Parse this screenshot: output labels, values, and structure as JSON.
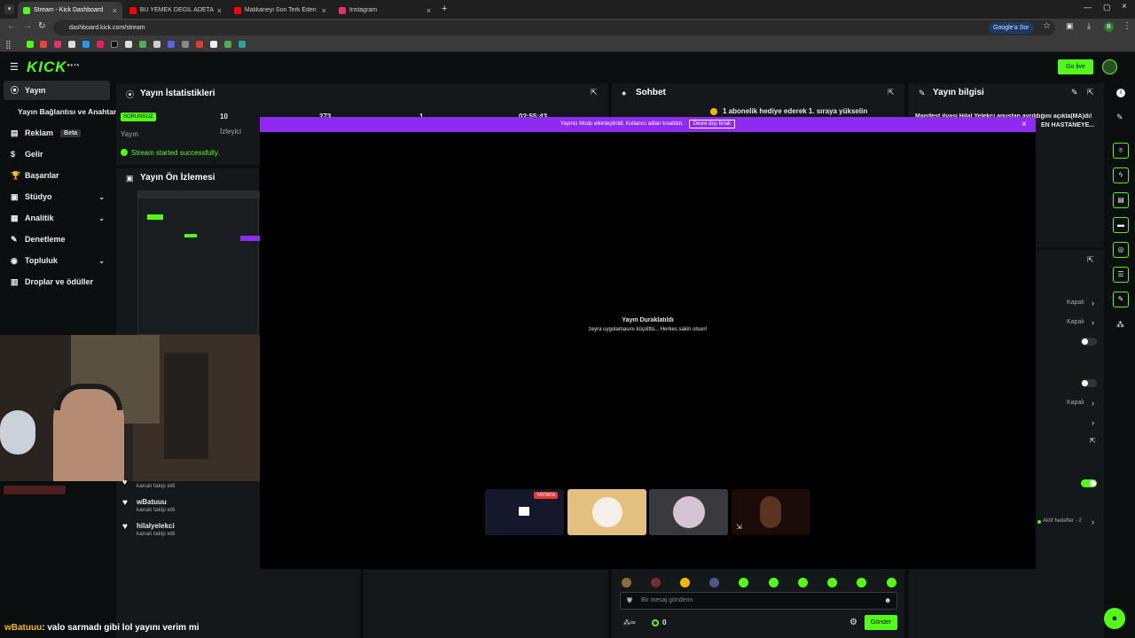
{
  "browser": {
    "tabs": [
      {
        "label": "Stream - Kick Dashboard",
        "color": "#53fc18"
      },
      {
        "label": "BU YEMEK DEĞİL ADETA ŞÖLEN",
        "color": "#ff0000"
      },
      {
        "label": "Malikaneyi Son Terk Eden Kazan",
        "color": "#ff0000"
      },
      {
        "label": "Instagram",
        "color": "#e1306c"
      }
    ],
    "url": "dashboard.kick.com/stream",
    "google_sor": "Google'a Sor",
    "profile_letter": "B"
  },
  "app": {
    "logo": "KICK",
    "logo_sup": "BETA",
    "go_live": "Go live"
  },
  "sidebar": {
    "items": [
      {
        "label": "Yayın",
        "icon": "broadcast-icon"
      },
      {
        "label": "Yayın Bağlantısı ve Anahtarı",
        "icon": ""
      },
      {
        "label": "Reklam",
        "icon": "ad-icon",
        "badge": "Beta"
      },
      {
        "label": "Gelir",
        "icon": "money-icon"
      },
      {
        "label": "Başarılar",
        "icon": "trophy-icon"
      },
      {
        "label": "Stüdyo",
        "icon": "studio-icon"
      },
      {
        "label": "Analitik",
        "icon": "chart-icon"
      },
      {
        "label": "Denetleme",
        "icon": "wrench-icon"
      },
      {
        "label": "Topluluk",
        "icon": "community-icon"
      },
      {
        "label": "Droplar ve ödüller",
        "icon": "gift-icon"
      }
    ]
  },
  "stats": {
    "title": "Yayın İstatistikleri",
    "status_badge": "SORUNSUZ",
    "status_label": "Yayın",
    "viewers_value": "10",
    "viewers_label": "İzleyici",
    "col3": "273",
    "col4": "1",
    "duration": "02:55:43",
    "success_msg": "Stream started successfully."
  },
  "preview": {
    "title": "Yayın Ön İzlemesi"
  },
  "chat": {
    "title": "Sohbet",
    "pinned": "1 abonelik hediye ederek 1. sıraya yükselin",
    "input_placeholder": "Bir mesaj gönderin",
    "send": "Gönder",
    "viewer_count": "0"
  },
  "stream_info": {
    "title": "Yayın bilgisi",
    "text_line1": "Manifest ilyasi Hilal Yelekçi anustan ayrıldığını açıkla(MA)dı!",
    "text_line2": "EN HASTANEYE..."
  },
  "settings": {
    "kapali1": "Kapalı",
    "kapali2": "Kapalı",
    "kapali3": "Kapalı",
    "aktif_hedefler": "Aktif hedefler - 2"
  },
  "modal": {
    "banner": "Yayıncı Modu etkinleştirildi. Kullanıcı adları kısaltıldı.",
    "banner_btn": "Devre dışı bırak",
    "paused_title": "Yayın Duraklatıldı",
    "paused_sub": "zeyra uygulamasını küçülttü... Herkes sakin olsun!",
    "live_badge": "YAYINDA"
  },
  "follows": [
    {
      "name": "",
      "action": "kanalı takip etti"
    },
    {
      "name": "wBatuuu",
      "action": "kanalı takip etti"
    },
    {
      "name": "hilalyelekci",
      "action": "kanalı takip etti"
    }
  ],
  "overlay_chat": {
    "user": "wBatuuu",
    "message": ": valo sarmadı gibi lol yayını verim mi"
  },
  "colors": {
    "accent": "#53fc18",
    "purple": "#8f2bf0",
    "panel": "#15181a"
  }
}
